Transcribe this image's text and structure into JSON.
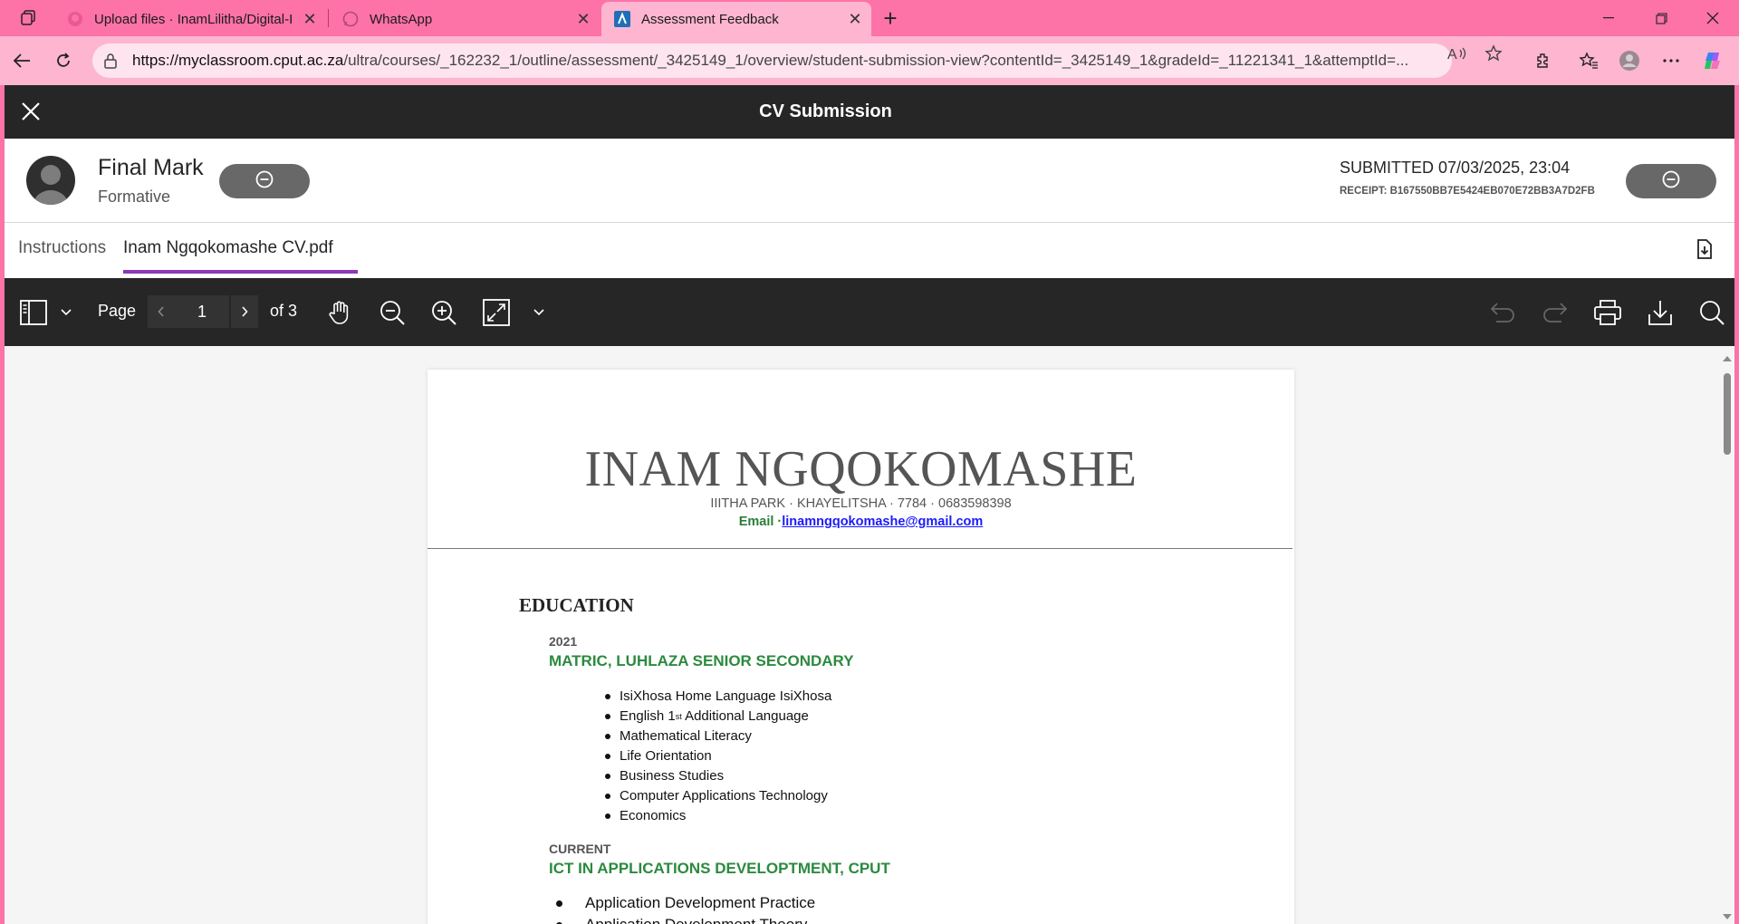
{
  "browser": {
    "tabs": [
      {
        "title": "Upload files · InamLilitha/Digital-I",
        "icon": "github-icon"
      },
      {
        "title": "WhatsApp",
        "icon": "whatsapp-icon"
      },
      {
        "title": "Assessment Feedback",
        "icon": "blackboard-icon",
        "active": true
      }
    ],
    "url_host": "https://myclassroom.cput.ac.za",
    "url_path": "/ultra/courses/_162232_1/outline/assessment/_3425149_1/overview/student-submission-view?contentId=_3425149_1&gradeId=_11221341_1&attemptId=..."
  },
  "modal": {
    "title": "CV Submission"
  },
  "grade": {
    "final_mark_label": "Final Mark",
    "type": "Formative",
    "submitted": "SUBMITTED 07/03/2025, 23:04",
    "receipt": "RECEIPT: B167550BB7E5424EB070E72BB3A7D2FB"
  },
  "doc_tabs": {
    "instructions": "Instructions",
    "file": "Inam Ngqokomashe CV.pdf"
  },
  "pdf_toolbar": {
    "page_label": "Page",
    "page_current": "1",
    "page_total": "of 3"
  },
  "cv": {
    "name": "INAM NGQOKOMASHE",
    "contact": "IIITHA PARK · KHAYELITSHA  · 7784   · 0683598398",
    "email_label": "Email ·",
    "email": "linamngqokomashe@gmail.com",
    "section_education": "EDUCATION",
    "edu1_year": "2021",
    "edu1_title": "MATRIC, LUHLAZA SENIOR SECONDARY",
    "edu1_subjects": [
      "IsiXhosa Home Language IsiXhosa",
      "English 1",
      "Mathematical Literacy",
      "Life Orientation",
      "Business Studies",
      "Computer Applications Technology",
      "Economics"
    ],
    "english_sup": "st",
    "english_rest": " Additional Language",
    "edu2_year": "CURRENT",
    "edu2_title": "ICT IN APPLICATIONS DEVELOPTMENT, CPUT",
    "edu2_subjects": [
      "Application Development Practice",
      "Application Development Theory"
    ]
  }
}
